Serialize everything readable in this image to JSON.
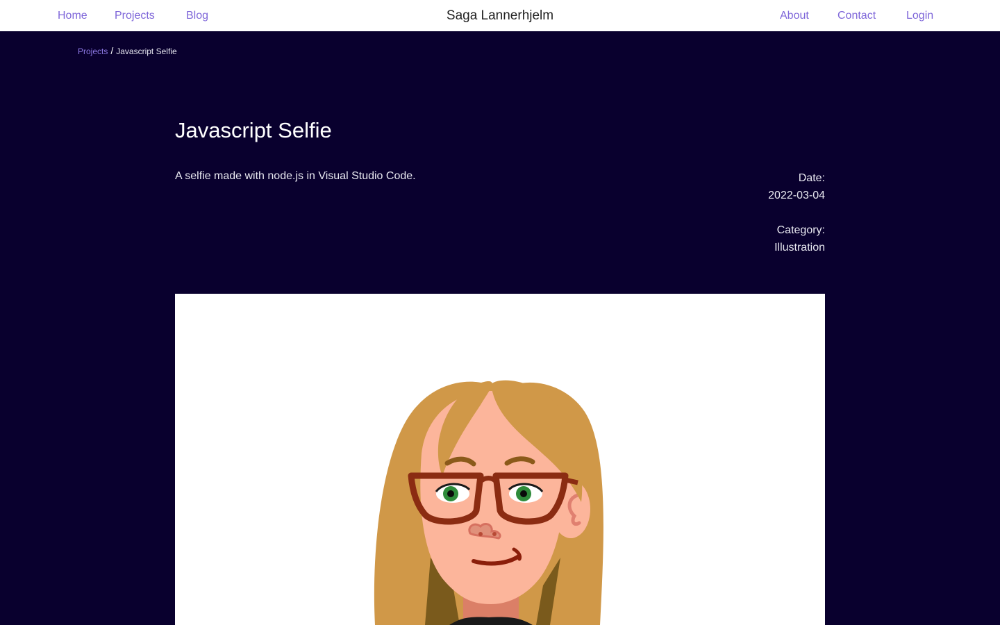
{
  "nav": {
    "home": "Home",
    "projects": "Projects",
    "blog": "Blog",
    "brand": "Saga Lannerhjelm",
    "about": "About",
    "contact": "Contact",
    "login": "Login"
  },
  "breadcrumb": {
    "parent": "Projects",
    "separator": "/",
    "current": "Javascript Selfie"
  },
  "project": {
    "title": "Javascript Selfie",
    "description": "A selfie made with node.js in Visual Studio Code.",
    "date_label": "Date:",
    "date_value": "2022-03-04",
    "category_label": "Category:",
    "category_value": "Illustration"
  },
  "colors": {
    "page_background": "#09002e",
    "nav_background": "#ffffff",
    "link": "#7e66d9",
    "hair": "#d09848",
    "skin": "#fcb59b",
    "glasses": "#8b2c12",
    "eyes": "#2e8b3a"
  },
  "image": {
    "alt_icon": "selfie-illustration"
  }
}
